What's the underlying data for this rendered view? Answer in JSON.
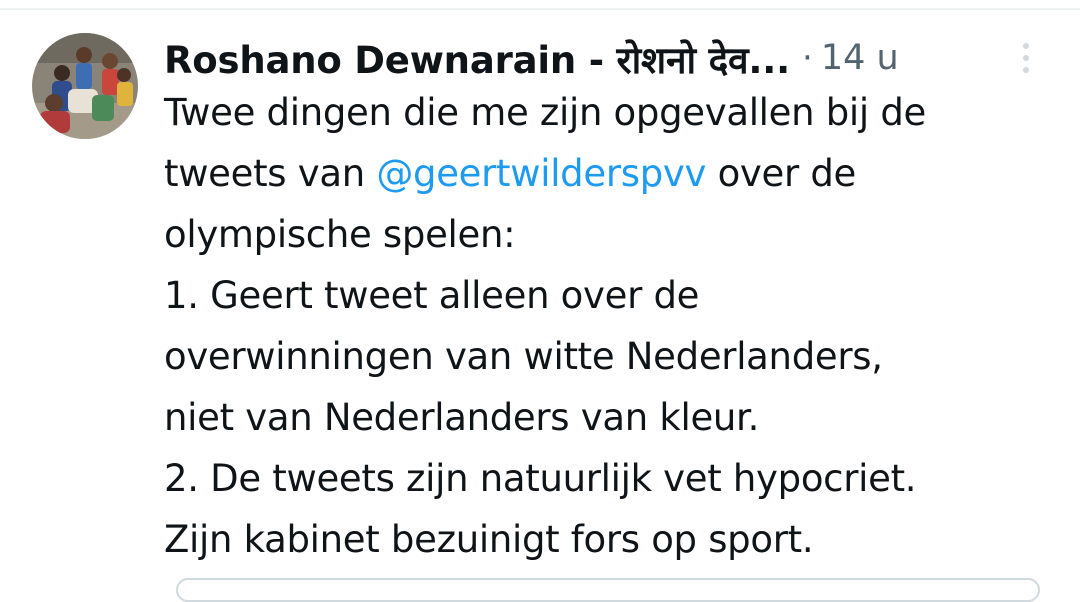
{
  "tweet": {
    "author": {
      "display_name": "Roshano Dewnarain - रोशनो देव...",
      "avatar_icon": "profile-photo-avatar"
    },
    "separator": "·",
    "timestamp": "14 u",
    "more_icon": "more-vertical-icon",
    "lines": [
      {
        "segments": [
          {
            "text": "Twee dingen die me zijn opgevallen bij de"
          }
        ]
      },
      {
        "segments": [
          {
            "text": "tweets van "
          },
          {
            "text": "@geertwilderspvv",
            "mention": true
          },
          {
            "text": " over de"
          }
        ]
      },
      {
        "segments": [
          {
            "text": "olympische spelen:"
          }
        ]
      },
      {
        "segments": [
          {
            "text": "1. Geert tweet alleen over de"
          }
        ]
      },
      {
        "segments": [
          {
            "text": "overwinningen van witte Nederlanders,"
          }
        ]
      },
      {
        "segments": [
          {
            "text": "niet van Nederlanders van kleur."
          }
        ]
      },
      {
        "segments": [
          {
            "text": "2. De tweets zijn natuurlijk vet hypocriet."
          }
        ]
      },
      {
        "segments": [
          {
            "text": "Zijn kabinet bezuinigt fors op sport."
          }
        ]
      }
    ]
  },
  "colors": {
    "text_primary": "#0f1419",
    "text_secondary": "#536471",
    "link_blue": "#1d9bf0",
    "border": "#eff3f4"
  }
}
